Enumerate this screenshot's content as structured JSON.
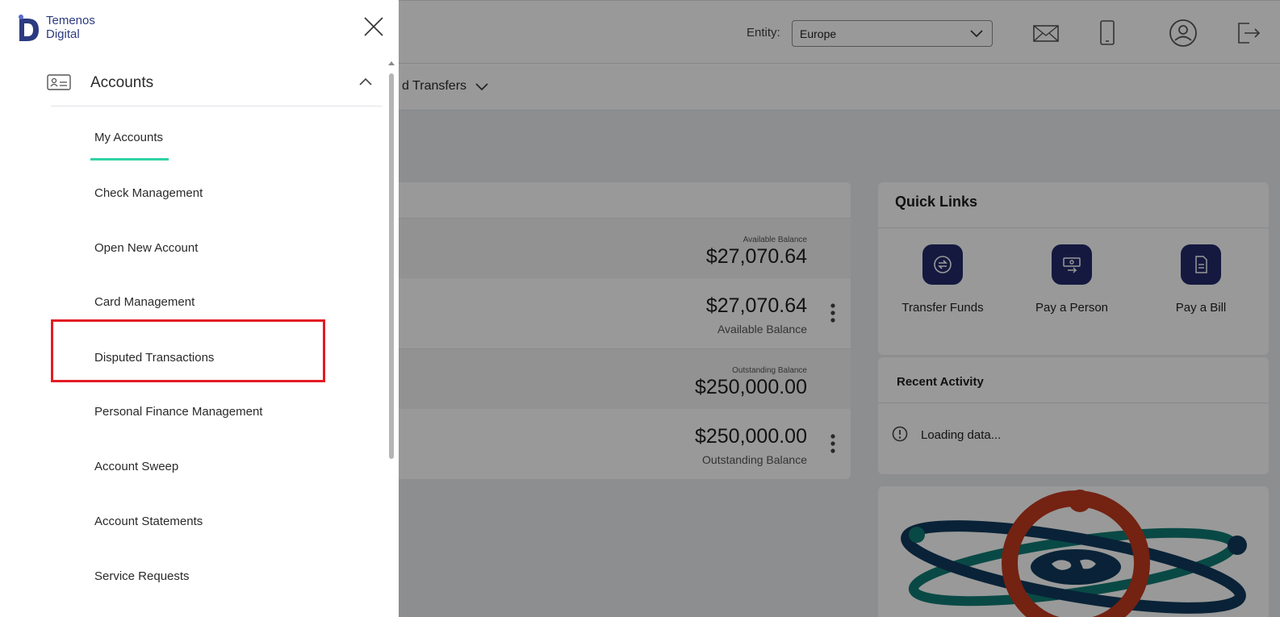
{
  "header": {
    "entity_label": "Entity:",
    "entity_value": "Europe",
    "icons": [
      "mail-icon",
      "mobile-icon",
      "user-profile-icon",
      "logout-icon"
    ]
  },
  "navbar": {
    "transfers_label": "d Transfers"
  },
  "accounts": {
    "rows": [
      {
        "kind": "group",
        "label": "Available Balance",
        "amount": "$27,070.64"
      },
      {
        "kind": "item",
        "amount": "$27,070.64",
        "label": "Available Balance"
      },
      {
        "kind": "group",
        "label": "Outstanding Balance",
        "amount": "$250,000.00"
      },
      {
        "kind": "item",
        "amount": "$250,000.00",
        "label": "Outstanding Balance"
      }
    ]
  },
  "quick_links": {
    "title": "Quick Links",
    "items": [
      {
        "label": "Transfer Funds",
        "icon": "transfer-icon"
      },
      {
        "label": "Pay a Person",
        "icon": "pay-person-icon"
      },
      {
        "label": "Pay a Bill",
        "icon": "bill-icon"
      }
    ]
  },
  "recent_activity": {
    "title": "Recent Activity",
    "status": "Loading data..."
  },
  "drawer": {
    "logo_line1": "Temenos",
    "logo_line2": "Digital",
    "section_title": "Accounts",
    "items": [
      "My Accounts",
      "Check Management",
      "Open New Account",
      "Card Management",
      "Disputed Transactions",
      "Personal Finance Management",
      "Account Sweep",
      "Account Statements",
      "Service Requests"
    ],
    "active_item": "My Accounts",
    "highlighted_item": "Disputed Transactions"
  },
  "colors": {
    "accent_underline": "#2ed3a4",
    "highlight_border": "#e21b24",
    "quick_link_icon_bg": "#232b6b",
    "brand_text": "#2c3a80"
  }
}
